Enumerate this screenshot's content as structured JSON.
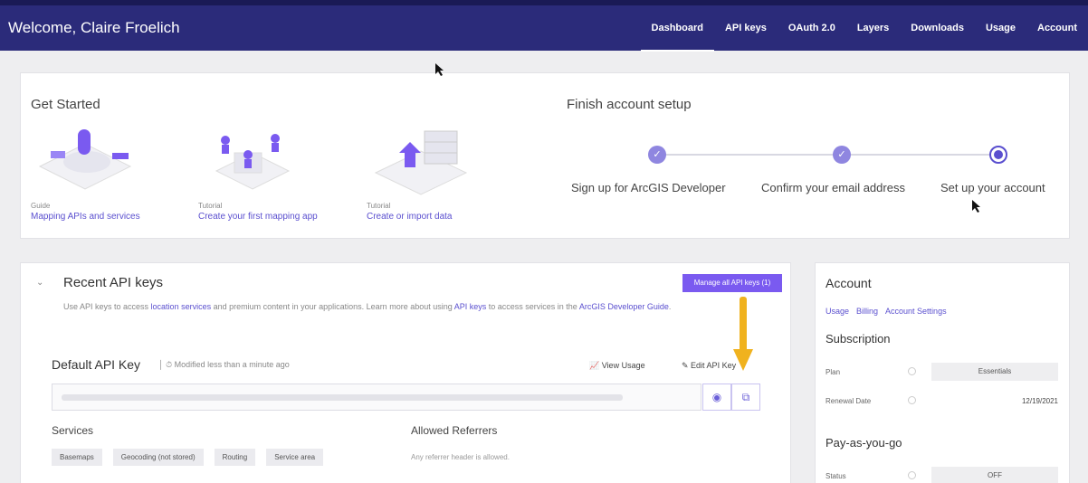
{
  "header": {
    "welcome": "Welcome, Claire Froelich",
    "nav": [
      "Dashboard",
      "API keys",
      "OAuth 2.0",
      "Layers",
      "Downloads",
      "Usage",
      "Account"
    ]
  },
  "get_started": {
    "title": "Get Started",
    "items": [
      {
        "type": "Guide",
        "link": "Mapping APIs and services"
      },
      {
        "type": "Tutorial",
        "link": "Create your first mapping app"
      },
      {
        "type": "Tutorial",
        "link": "Create or import data"
      }
    ]
  },
  "finish_setup": {
    "title": "Finish account setup",
    "steps": [
      "Sign up for ArcGIS Developer",
      "Confirm your email address",
      "Set up your account"
    ]
  },
  "api_keys": {
    "title": "Recent API keys",
    "manage_label": "Manage all API keys (1)",
    "desc_1": "Use API keys to access ",
    "desc_link_1": "location services",
    "desc_2": " and premium content in your applications. Learn more about using ",
    "desc_link_2": "API keys",
    "desc_3": " to access services in the ",
    "desc_link_3": "ArcGIS Developer Guide",
    "desc_4": ".",
    "key_name": "Default API Key",
    "modified": "Modified less than a minute ago",
    "view_usage": "View Usage",
    "edit_key": "Edit API Key",
    "services_label": "Services",
    "services": [
      "Basemaps",
      "Geocoding (not stored)",
      "Routing",
      "Service area"
    ],
    "referrers_label": "Allowed Referrers",
    "referrers_note": "Any referrer header is allowed."
  },
  "account": {
    "title": "Account",
    "links": [
      "Usage",
      "Billing",
      "Account Settings"
    ],
    "subscription_title": "Subscription",
    "plan_label": "Plan",
    "plan_value": "Essentials",
    "renewal_label": "Renewal Date",
    "renewal_value": "12/19/2021",
    "payg_title": "Pay-as-you-go",
    "status_label": "Status",
    "status_value": "OFF"
  },
  "colors": {
    "header_bg": "#2b2b7a",
    "accent": "#5a4fcf",
    "button": "#7a5af0",
    "arrow": "#f0b21e"
  }
}
